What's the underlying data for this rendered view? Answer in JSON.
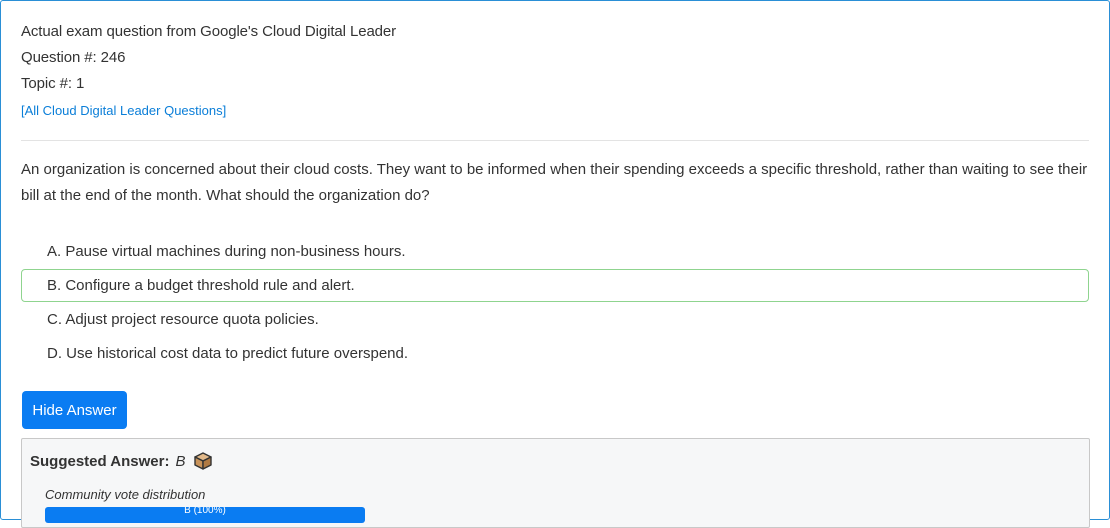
{
  "header": {
    "title": "Actual exam question from Google's Cloud Digital Leader",
    "question_number": "Question #: 246",
    "topic_number": "Topic #: 1",
    "all_questions_link": "[All Cloud Digital Leader Questions]"
  },
  "question": {
    "text": "An organization is concerned about their cloud costs. They want to be informed when their spending exceeds a specific threshold, rather than waiting to see their bill at the end of the month. What should the organization do?"
  },
  "choices": [
    {
      "label": "A. Pause virtual machines during non-business hours."
    },
    {
      "label": "B. Configure a budget threshold rule and alert."
    },
    {
      "label": "C. Adjust project resource quota policies."
    },
    {
      "label": "D. Use historical cost data to predict future overspend."
    }
  ],
  "toggle_button": {
    "label": "Hide Answer"
  },
  "answer": {
    "suggested_label": "Suggested Answer:",
    "suggested_value": "B",
    "icon": "box-icon",
    "vote_label": "Community vote distribution",
    "vote_bar_label": "B (100%)",
    "vote_fraction": 1.0
  },
  "colors": {
    "accent": "#0a7cf2",
    "link": "#0a7ed8",
    "correct_border": "#8fd48f",
    "frame_border": "#2a8fd6"
  }
}
